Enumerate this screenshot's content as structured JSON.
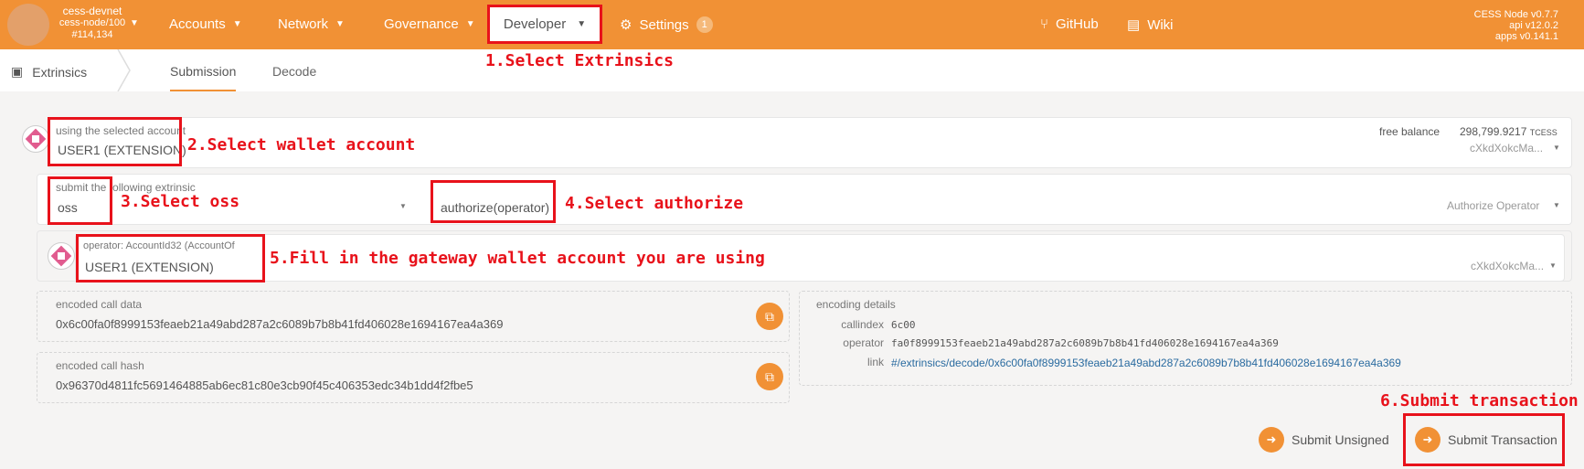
{
  "topbar": {
    "chain_name": "cess-devnet",
    "chain_node": "cess-node/100",
    "chain_block": "#114,134",
    "nav": [
      "Accounts",
      "Network",
      "Governance",
      "Developer",
      "Settings"
    ],
    "settings_badge": "1",
    "links": [
      "GitHub",
      "Wiki"
    ],
    "node_version": "CESS Node v0.7.7",
    "api_version": "api v12.0.2",
    "apps_version": "apps v0.141.1"
  },
  "subnav": {
    "section": "Extrinsics",
    "tabs": [
      "Submission",
      "Decode"
    ],
    "active_tab": "Submission"
  },
  "account": {
    "label": "using the selected account",
    "value": "USER1 (EXTENSION)",
    "balance_label": "free balance",
    "balance_value": "298,799.9217",
    "balance_unit": "TCESS",
    "address_short": "cXkdXokcMa..."
  },
  "extrinsic": {
    "label": "submit the following extrinsic",
    "pallet": "oss",
    "call": "authorize(operator)",
    "call_doc": "Authorize Operator"
  },
  "operator": {
    "label": "operator: AccountId32 (AccountOf",
    "value": "USER1 (EXTENSION)",
    "address_short": "cXkdXokcMa..."
  },
  "encoded_call_data": {
    "label": "encoded call data",
    "value": "0x6c00fa0f8999153feaeb21a49abd287a2c6089b7b8b41fd406028e1694167ea4a369"
  },
  "encoded_call_hash": {
    "label": "encoded call hash",
    "value": "0x96370d4811fc5691464885ab6ec81c80e3cb90f45c406353edc34b1dd4f2fbe5"
  },
  "encoding_details": {
    "label": "encoding details",
    "callindex_label": "callindex",
    "callindex_value": "6c00",
    "operator_label": "operator",
    "operator_value": "fa0f8999153feaeb21a49abd287a2c6089b7b8b41fd406028e1694167ea4a369",
    "link_label": "link",
    "link_value": "#/extrinsics/decode/0x6c00fa0f8999153feaeb21a49abd287a2c6089b7b8b41fd406028e1694167ea4a369"
  },
  "actions": {
    "submit_unsigned": "Submit Unsigned",
    "submit_transaction": "Submit Transaction"
  },
  "annotations": {
    "step1": "1.Select Extrinsics",
    "step2": "2.Select wallet account",
    "step3": "3.Select oss",
    "step4": "4.Select authorize",
    "step5": "5.Fill in the gateway wallet account you are using",
    "step6": "6.Submit transaction"
  },
  "colors": {
    "brand": "#f19135",
    "annotation": "#e8121b",
    "link": "#2a6ba0"
  }
}
